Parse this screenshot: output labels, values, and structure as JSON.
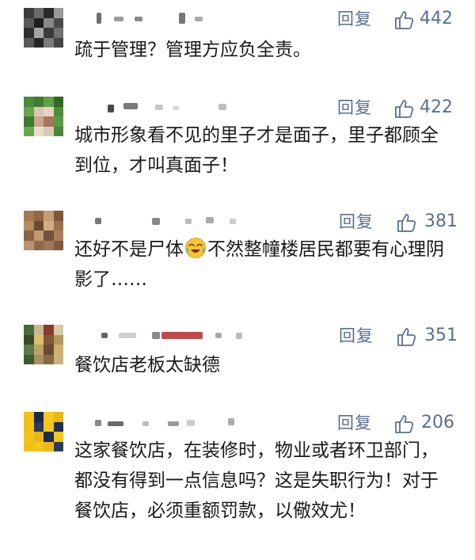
{
  "reply_label": "回复",
  "colors": {
    "meta": "#5c6f8f",
    "text": "#1a1a1a",
    "background": "#ffffff"
  },
  "comments": [
    {
      "likes": "442",
      "text": "疏于管理？管理方应负全责。",
      "avatar_colors": [
        "#3c3c3c",
        "#6b6b6b",
        "#2a2a2a",
        "#9a9a9a",
        "#5a5a5a",
        "#1e1e1e",
        "#8a8a8a",
        "#4a4a4a",
        "#2f2f2f",
        "#a5a5a5",
        "#3a3a3a",
        "#707070",
        "#595959",
        "#262626",
        "#7b7b7b",
        "#444444"
      ]
    },
    {
      "likes": "422",
      "text": "城市形象看不见的里子才是面子，里子都顾全到位，才叫真面子！",
      "avatar_colors": [
        "#4c8a3a",
        "#3f7a30",
        "#5da048",
        "#2f6a22",
        "#6aa34f",
        "#d9c7b3",
        "#e7d3bf",
        "#4f8d3c",
        "#3b7b2d",
        "#c9a58e",
        "#a9735e",
        "#5b9a46",
        "#6aa854",
        "#e6e0cf",
        "#d8cbb6",
        "#4a8637"
      ]
    },
    {
      "likes": "381",
      "text_before": "还好不是尸体",
      "emoji": "crying-laughing-emoji",
      "text_after": "不然整幢楼居民都要有心理阴影了……",
      "avatar_colors": [
        "#a77a52",
        "#8f6844",
        "#c79c72",
        "#7a583a",
        "#b58b61",
        "#6b4b30",
        "#d1ad86",
        "#9b7150",
        "#8a6446",
        "#c29a70",
        "#74533a",
        "#a87f5a",
        "#b99470",
        "#8c6a4c",
        "#a07754",
        "#7e5c40"
      ]
    },
    {
      "likes": "351",
      "text": "餐饮店老板太缺德",
      "avatar_colors": [
        "#4a6a3a",
        "#c9b78e",
        "#8a3a2a",
        "#d9c9a5",
        "#3a4a2a",
        "#e0c070",
        "#7a5a3a",
        "#b0985e",
        "#5a7a4a",
        "#c0a060",
        "#6a4a30",
        "#d0b070",
        "#3f5a30",
        "#a89060",
        "#8a6a40",
        "#c8b080"
      ]
    },
    {
      "likes": "206",
      "text": "这家餐饮店，在装修时，物业或者环卫部门，都没有得到一点信息吗？这是失职行为！对于餐饮店，必须重额罚款，以儆效尤！",
      "avatar_colors": [
        "#f2c21b",
        "#1b2a4a",
        "#f4c820",
        "#e9b817",
        "#f0c21a",
        "#2a3a5a",
        "#f3c51e",
        "#1f2f50",
        "#f1c31c",
        "#e8b716",
        "#1c2b4b",
        "#f2c41d",
        "#f0c01a",
        "#f4c71f",
        "#ebb918",
        "#2b3b5b"
      ]
    }
  ]
}
